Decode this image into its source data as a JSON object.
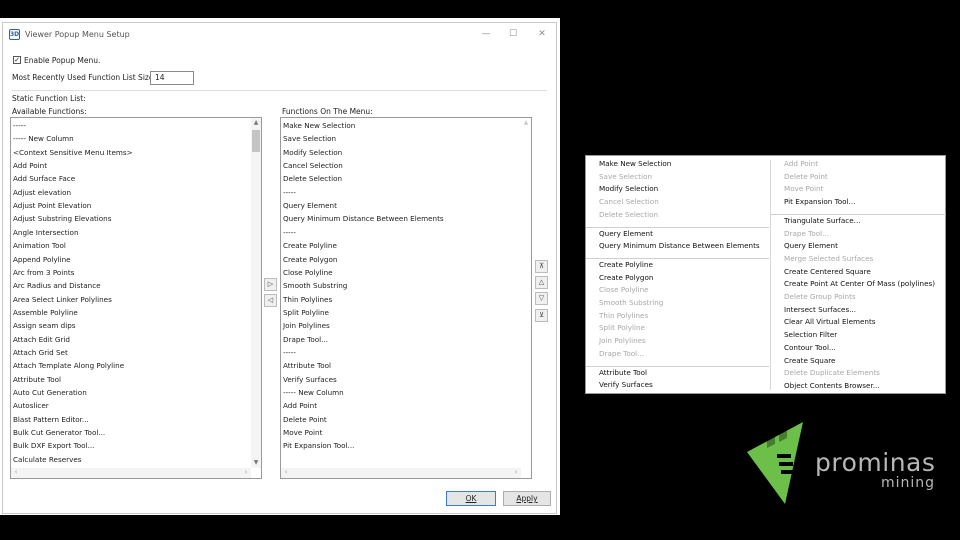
{
  "window": {
    "title": "Viewer Popup Menu Setup",
    "icon_text": "3D",
    "minimize_glyph": "—",
    "maximize_glyph": "☐",
    "close_glyph": "✕"
  },
  "options": {
    "enable_label": "Enable Popup Menu.",
    "enable_checked": true,
    "mru_label": "Most Recently Used Function List Size:",
    "mru_value": "14",
    "static_label": "Static Function List:"
  },
  "available": {
    "header": "Available Functions:",
    "items": [
      "-----",
      "----- New Column",
      "<Context Sensitive Menu Items>",
      "Add Point",
      "Add Surface Face",
      "Adjust elevation",
      "Adjust Point Elevation",
      "Adjust Substring Elevations",
      "Angle Intersection",
      "Animation Tool",
      "Append Polyline",
      "Arc from 3 Points",
      "Arc Radius and Distance",
      "Area Select Linker Polylines",
      "Assemble Polyline",
      "Assign seam dips",
      "Attach Edit Grid",
      "Attach Grid Set",
      "Attach Template Along Polyline",
      "Attribute Tool",
      "Auto Cut Generation",
      "Autoslicer",
      "Blast Pattern Editor...",
      "Bulk Cut Generator Tool...",
      "Bulk DXF Export Tool...",
      "Calculate Reserves"
    ]
  },
  "on_menu": {
    "header": "Functions On The Menu:",
    "items": [
      "Make New Selection",
      "Save Selection",
      "Modify Selection",
      "Cancel Selection",
      "Delete Selection",
      "-----",
      "Query Element",
      "Query Minimum Distance Between Elements",
      "-----",
      "Create Polyline",
      "Create Polygon",
      "Close Polyline",
      "Smooth Substring",
      "Thin Polylines",
      "Split Polyline",
      "Join Polylines",
      "Drape Tool...",
      "-----",
      "Attribute Tool",
      "Verify Surfaces",
      "----- New Column",
      "Add Point",
      "Delete Point",
      "Move Point",
      "Pit Expansion Tool..."
    ]
  },
  "buttons": {
    "ok": "OK",
    "apply": "Apply",
    "add_glyph": "▷",
    "remove_glyph": "◁",
    "top_glyph": "⊼",
    "up_glyph": "△",
    "down_glyph": "▽",
    "bottom_glyph": "⊻"
  },
  "popup_menu": {
    "col1": [
      {
        "label": "Make New Selection",
        "enabled": true
      },
      {
        "label": "Save Selection",
        "enabled": false
      },
      {
        "label": "Modify Selection",
        "enabled": true
      },
      {
        "label": "Cancel Selection",
        "enabled": false
      },
      {
        "label": "Delete Selection",
        "enabled": false
      },
      {
        "sep": true
      },
      {
        "label": "Query Element",
        "enabled": true
      },
      {
        "label": "Query Minimum Distance Between Elements",
        "enabled": true
      },
      {
        "sep": true
      },
      {
        "label": "Create Polyline",
        "enabled": true
      },
      {
        "label": "Create Polygon",
        "enabled": true
      },
      {
        "label": "Close Polyline",
        "enabled": false
      },
      {
        "label": "Smooth Substring",
        "enabled": false
      },
      {
        "label": "Thin Polylines",
        "enabled": false
      },
      {
        "label": "Split Polyline",
        "enabled": false
      },
      {
        "label": "Join Polylines",
        "enabled": false
      },
      {
        "label": "Drape Tool...",
        "enabled": false
      },
      {
        "sep": true
      },
      {
        "label": "Attribute Tool",
        "enabled": true
      },
      {
        "label": "Verify Surfaces",
        "enabled": true
      }
    ],
    "col2": [
      {
        "label": "Add Point",
        "enabled": false
      },
      {
        "label": "Delete Point",
        "enabled": false
      },
      {
        "label": "Move Point",
        "enabled": false
      },
      {
        "label": "Pit Expansion Tool...",
        "enabled": true
      },
      {
        "sep": true
      },
      {
        "label": "Triangulate Surface...",
        "enabled": true
      },
      {
        "label": "Drape Tool...",
        "enabled": false
      },
      {
        "label": "Query Element",
        "enabled": true
      },
      {
        "label": "Merge Selected Surfaces",
        "enabled": false
      },
      {
        "label": "Create Centered Square",
        "enabled": true
      },
      {
        "label": "Create Point At Center Of Mass (polylines)",
        "enabled": true
      },
      {
        "label": "Delete Group Points",
        "enabled": false
      },
      {
        "label": "Intersect Surfaces...",
        "enabled": true
      },
      {
        "label": "Clear All Virtual Elements",
        "enabled": true
      },
      {
        "label": "Selection Filter",
        "enabled": true
      },
      {
        "label": "Contour Tool...",
        "enabled": true
      },
      {
        "label": "Create Square",
        "enabled": true
      },
      {
        "label": "Delete Duplicate Elements",
        "enabled": false
      },
      {
        "label": "Object Contents Browser...",
        "enabled": true
      }
    ]
  },
  "logo": {
    "name": "prominas",
    "sub": "mining",
    "color": "#6cc04a"
  }
}
